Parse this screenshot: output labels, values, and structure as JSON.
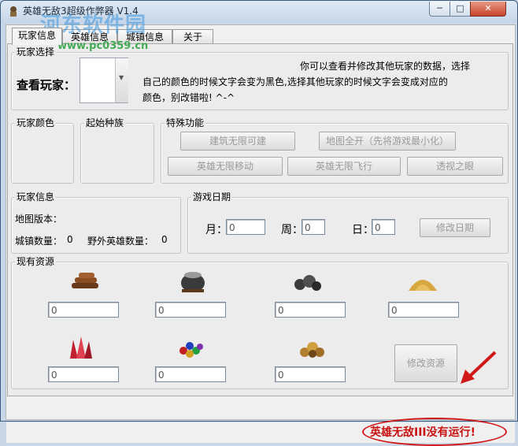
{
  "window": {
    "title": "英雄无敌3超级作弊器 V1.4",
    "minimize_label": "─",
    "maximize_label": "□",
    "close_label": "✕"
  },
  "watermark": {
    "main": "河东软件园",
    "url": "www.pc0359.cn"
  },
  "tabs": [
    {
      "label": "玩家信息",
      "active": true
    },
    {
      "label": "英雄信息",
      "active": false
    },
    {
      "label": "城镇信息",
      "active": false
    },
    {
      "label": "关于",
      "active": false
    }
  ],
  "player_select": {
    "group_label": "玩家选择",
    "view_label": "查看玩家：",
    "dropdown_value": "",
    "note_line1": "你可以查看并修改其他玩家的数据，选择",
    "note_line2": "自己的颜色的时候文字会变为黑色,选择其他玩家的时候文字会变成对应的",
    "note_line3": "颜色，别改错啦! ^-^"
  },
  "player_color": {
    "group_label": "玩家颜色"
  },
  "start_race": {
    "group_label": "起始种族"
  },
  "special": {
    "group_label": "特殊功能",
    "buttons": [
      "建筑无限可建",
      "地图全开（先将游戏最小化）",
      "英雄无限移动",
      "英雄无限飞行",
      "透视之眼"
    ]
  },
  "player_info": {
    "group_label": "玩家信息",
    "map_version_label": "地图版本：",
    "town_count_label": "城镇数量：",
    "town_count": "0",
    "wild_hero_label": "野外英雄数量：",
    "wild_hero_count": "0"
  },
  "game_date": {
    "group_label": "游戏日期",
    "month_label": "月：",
    "month_value": "0",
    "week_label": "周：",
    "week_value": "0",
    "day_label": "日：",
    "day_value": "0",
    "modify_label": "修改日期"
  },
  "resources": {
    "group_label": "现有资源",
    "items": [
      {
        "icon": "wood-icon",
        "value": "0"
      },
      {
        "icon": "mercury-icon",
        "value": "0"
      },
      {
        "icon": "ore-icon",
        "value": "0"
      },
      {
        "icon": "sulfur-icon",
        "value": "0"
      },
      {
        "icon": "crystal-icon",
        "value": "0"
      },
      {
        "icon": "gems-icon",
        "value": "0"
      },
      {
        "icon": "gold-icon",
        "value": "0"
      }
    ],
    "modify_label": "修改资源"
  },
  "status": {
    "text": "英雄无敌III没有运行!"
  },
  "colors": {
    "status_red": "#c81010",
    "watermark_blue": "#3c96dc"
  }
}
